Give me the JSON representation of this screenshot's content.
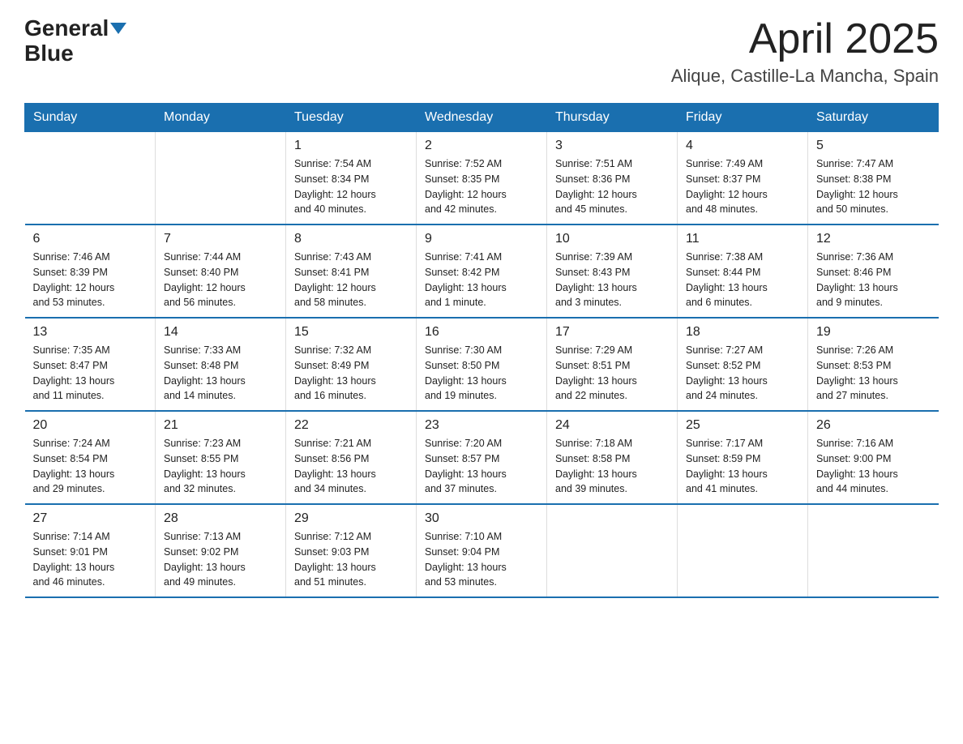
{
  "logo": {
    "text_general": "General",
    "text_blue": "Blue",
    "arrow": true
  },
  "header": {
    "month": "April 2025",
    "location": "Alique, Castille-La Mancha, Spain"
  },
  "weekdays": [
    "Sunday",
    "Monday",
    "Tuesday",
    "Wednesday",
    "Thursday",
    "Friday",
    "Saturday"
  ],
  "weeks": [
    [
      {
        "day": "",
        "info": ""
      },
      {
        "day": "",
        "info": ""
      },
      {
        "day": "1",
        "info": "Sunrise: 7:54 AM\nSunset: 8:34 PM\nDaylight: 12 hours\nand 40 minutes."
      },
      {
        "day": "2",
        "info": "Sunrise: 7:52 AM\nSunset: 8:35 PM\nDaylight: 12 hours\nand 42 minutes."
      },
      {
        "day": "3",
        "info": "Sunrise: 7:51 AM\nSunset: 8:36 PM\nDaylight: 12 hours\nand 45 minutes."
      },
      {
        "day": "4",
        "info": "Sunrise: 7:49 AM\nSunset: 8:37 PM\nDaylight: 12 hours\nand 48 minutes."
      },
      {
        "day": "5",
        "info": "Sunrise: 7:47 AM\nSunset: 8:38 PM\nDaylight: 12 hours\nand 50 minutes."
      }
    ],
    [
      {
        "day": "6",
        "info": "Sunrise: 7:46 AM\nSunset: 8:39 PM\nDaylight: 12 hours\nand 53 minutes."
      },
      {
        "day": "7",
        "info": "Sunrise: 7:44 AM\nSunset: 8:40 PM\nDaylight: 12 hours\nand 56 minutes."
      },
      {
        "day": "8",
        "info": "Sunrise: 7:43 AM\nSunset: 8:41 PM\nDaylight: 12 hours\nand 58 minutes."
      },
      {
        "day": "9",
        "info": "Sunrise: 7:41 AM\nSunset: 8:42 PM\nDaylight: 13 hours\nand 1 minute."
      },
      {
        "day": "10",
        "info": "Sunrise: 7:39 AM\nSunset: 8:43 PM\nDaylight: 13 hours\nand 3 minutes."
      },
      {
        "day": "11",
        "info": "Sunrise: 7:38 AM\nSunset: 8:44 PM\nDaylight: 13 hours\nand 6 minutes."
      },
      {
        "day": "12",
        "info": "Sunrise: 7:36 AM\nSunset: 8:46 PM\nDaylight: 13 hours\nand 9 minutes."
      }
    ],
    [
      {
        "day": "13",
        "info": "Sunrise: 7:35 AM\nSunset: 8:47 PM\nDaylight: 13 hours\nand 11 minutes."
      },
      {
        "day": "14",
        "info": "Sunrise: 7:33 AM\nSunset: 8:48 PM\nDaylight: 13 hours\nand 14 minutes."
      },
      {
        "day": "15",
        "info": "Sunrise: 7:32 AM\nSunset: 8:49 PM\nDaylight: 13 hours\nand 16 minutes."
      },
      {
        "day": "16",
        "info": "Sunrise: 7:30 AM\nSunset: 8:50 PM\nDaylight: 13 hours\nand 19 minutes."
      },
      {
        "day": "17",
        "info": "Sunrise: 7:29 AM\nSunset: 8:51 PM\nDaylight: 13 hours\nand 22 minutes."
      },
      {
        "day": "18",
        "info": "Sunrise: 7:27 AM\nSunset: 8:52 PM\nDaylight: 13 hours\nand 24 minutes."
      },
      {
        "day": "19",
        "info": "Sunrise: 7:26 AM\nSunset: 8:53 PM\nDaylight: 13 hours\nand 27 minutes."
      }
    ],
    [
      {
        "day": "20",
        "info": "Sunrise: 7:24 AM\nSunset: 8:54 PM\nDaylight: 13 hours\nand 29 minutes."
      },
      {
        "day": "21",
        "info": "Sunrise: 7:23 AM\nSunset: 8:55 PM\nDaylight: 13 hours\nand 32 minutes."
      },
      {
        "day": "22",
        "info": "Sunrise: 7:21 AM\nSunset: 8:56 PM\nDaylight: 13 hours\nand 34 minutes."
      },
      {
        "day": "23",
        "info": "Sunrise: 7:20 AM\nSunset: 8:57 PM\nDaylight: 13 hours\nand 37 minutes."
      },
      {
        "day": "24",
        "info": "Sunrise: 7:18 AM\nSunset: 8:58 PM\nDaylight: 13 hours\nand 39 minutes."
      },
      {
        "day": "25",
        "info": "Sunrise: 7:17 AM\nSunset: 8:59 PM\nDaylight: 13 hours\nand 41 minutes."
      },
      {
        "day": "26",
        "info": "Sunrise: 7:16 AM\nSunset: 9:00 PM\nDaylight: 13 hours\nand 44 minutes."
      }
    ],
    [
      {
        "day": "27",
        "info": "Sunrise: 7:14 AM\nSunset: 9:01 PM\nDaylight: 13 hours\nand 46 minutes."
      },
      {
        "day": "28",
        "info": "Sunrise: 7:13 AM\nSunset: 9:02 PM\nDaylight: 13 hours\nand 49 minutes."
      },
      {
        "day": "29",
        "info": "Sunrise: 7:12 AM\nSunset: 9:03 PM\nDaylight: 13 hours\nand 51 minutes."
      },
      {
        "day": "30",
        "info": "Sunrise: 7:10 AM\nSunset: 9:04 PM\nDaylight: 13 hours\nand 53 minutes."
      },
      {
        "day": "",
        "info": ""
      },
      {
        "day": "",
        "info": ""
      },
      {
        "day": "",
        "info": ""
      }
    ]
  ]
}
